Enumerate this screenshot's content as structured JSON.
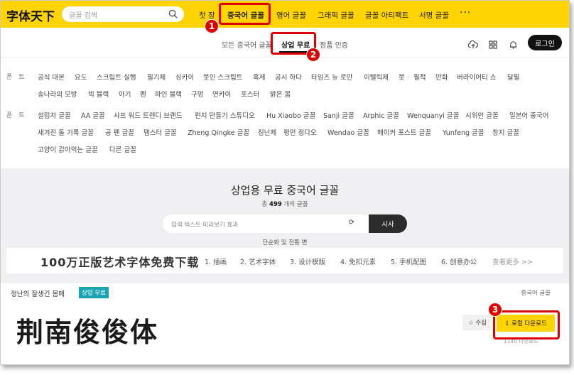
{
  "header": {
    "logo": "字体天下",
    "search_placeholder": "글꼴 검색",
    "nav": [
      "첫 장",
      "중국어 글꼴",
      "영어 글꼴",
      "그래픽 글꼴",
      "글꼴 아티팩트",
      "서명 글꼴"
    ],
    "more": "···"
  },
  "subnav": {
    "items": [
      "모든 중국어 글꼴",
      "상업 무료",
      "정품 인증"
    ],
    "login": "로그인"
  },
  "filters": {
    "row1_label": "폰트",
    "row1": [
      "공식 대본",
      "요도",
      "스크립트 실행",
      "필기체",
      "싱카이",
      "붓인 스크립트",
      "흑체",
      "공시 하다",
      "타임즈 뉴 로만",
      "이텔릭체",
      "붓",
      "필적",
      "만화",
      "버라이어티 쇼",
      "달필",
      "송나라의 모방",
      "빅 블랙",
      "아기",
      "펜",
      "파인 블랙",
      "구멍",
      "연카이",
      "포스터",
      "밝은 몸"
    ],
    "row2_label": "폰트",
    "row2": [
      "설립자 글꼴",
      "AA 글꼴",
      "샤프 워드 트렌디 브랜드",
      "펀지 만들기 스튜디오",
      "Hu Xiaobo 글꼴",
      "Sanji 글꼴",
      "Arphic 글꼴",
      "Wenquanyi 글꼴",
      "시위안 글꼴",
      "일본어 중국어",
      "새겨진 돌 기록 글꼴",
      "공 펜 글꼴",
      "템스터 글꼴",
      "Zheng Qingke 글꼴",
      "징난체",
      "평먼 정다오",
      "Wendao 글꼴",
      "메이커 포스트 글꼴",
      "Yunfeng 글꼴",
      "창지 글꼴",
      "고양이 갉아먹는 글꼴",
      "다른 글꼴"
    ]
  },
  "hero": {
    "title": "상업용 무료 중국어 글꼴",
    "count_prefix": "총",
    "count": "499",
    "count_suffix": "개의 글꼴",
    "preview_placeholder": "입력 텍스트 미리보기 효과",
    "preview_button": "시사",
    "traditional": "단순화 및 전통 변"
  },
  "banner": {
    "title": "100万正版艺术字体免费下载",
    "items": [
      "1. 插画",
      "2. 艺术字体",
      "3. 设计模版",
      "4. 免扣元素",
      "5. 手机配图",
      "6. 创意办公"
    ],
    "more": "查看更多 >>"
  },
  "font_card": {
    "name": "정난의 잘생긴 몸매",
    "badge": "상업 무료",
    "category": "중국어 글꼴",
    "sample": "荆南俊俊体",
    "favorite": "☆ 수집",
    "download": "⇩ 로컬 다운로드",
    "download_count": "1140 다운로드"
  },
  "annotations": [
    "1",
    "2",
    "3"
  ],
  "colors": {
    "accent": "#ffd400",
    "highlight": "#e00000",
    "badge": "#1aa3b5"
  }
}
